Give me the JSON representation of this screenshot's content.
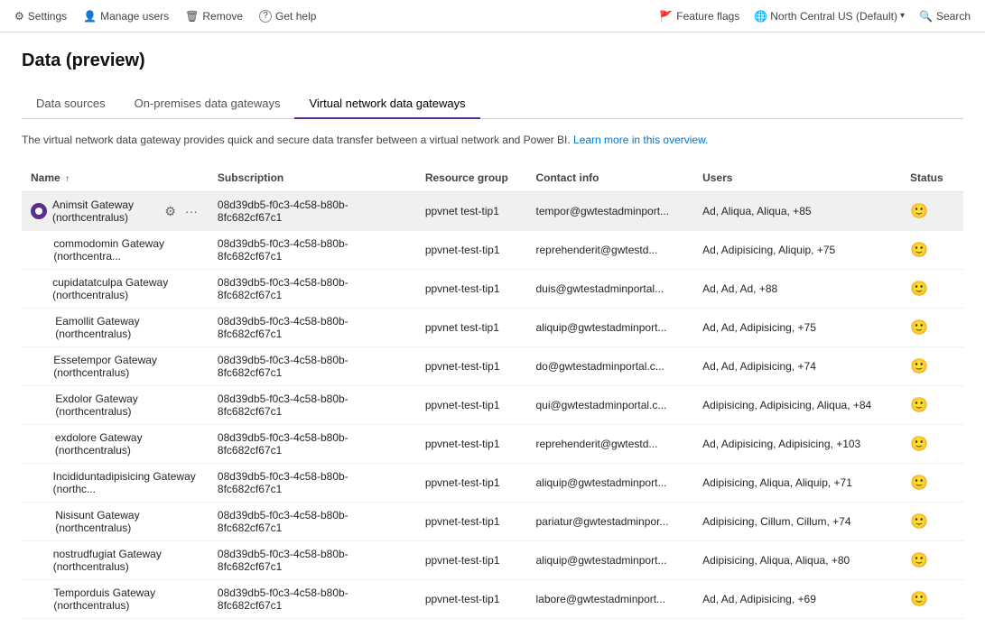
{
  "topbar": {
    "left": [
      {
        "id": "settings",
        "icon": "⚙",
        "label": "Settings"
      },
      {
        "id": "manage-users",
        "icon": "👤",
        "label": "Manage users"
      },
      {
        "id": "remove",
        "icon": "🗑",
        "label": "Remove"
      },
      {
        "id": "get-help",
        "icon": "?",
        "label": "Get help"
      }
    ],
    "right": {
      "feature_flags": "Feature flags",
      "region": "North Central US (Default)",
      "search": "Search"
    }
  },
  "page": {
    "title": "Data (preview)"
  },
  "tabs": [
    {
      "id": "data-sources",
      "label": "Data sources",
      "active": false
    },
    {
      "id": "on-premises",
      "label": "On-premises data gateways",
      "active": false
    },
    {
      "id": "virtual-network",
      "label": "Virtual network data gateways",
      "active": true
    }
  ],
  "description": {
    "text": "The virtual network data gateway provides quick and secure data transfer between a virtual network and Power BI.",
    "link_text": "Learn more in this overview.",
    "link_href": "#"
  },
  "table": {
    "columns": [
      {
        "id": "name",
        "label": "Name",
        "sort": "↑"
      },
      {
        "id": "subscription",
        "label": "Subscription"
      },
      {
        "id": "resource-group",
        "label": "Resource group"
      },
      {
        "id": "contact-info",
        "label": "Contact info"
      },
      {
        "id": "users",
        "label": "Users"
      },
      {
        "id": "status",
        "label": "Status"
      }
    ],
    "rows": [
      {
        "id": 1,
        "selected": true,
        "name": "Animsit Gateway (northcentralus)",
        "subscription": "08d39db5-f0c3-4c58-b80b-8fc682cf67c1",
        "resource_group": "ppvnet test-tip1",
        "contact_info": "tempor@gwtestadminport...",
        "users": "Ad, Aliqua, Aliqua, +85",
        "status": "ok"
      },
      {
        "id": 2,
        "selected": false,
        "name": "commodomin Gateway (northcentra...",
        "subscription": "08d39db5-f0c3-4c58-b80b-8fc682cf67c1",
        "resource_group": "ppvnet-test-tip1",
        "contact_info": "reprehenderit@gwtestd...",
        "users": "Ad, Adipisicing, Aliquip, +75",
        "status": "ok"
      },
      {
        "id": 3,
        "selected": false,
        "name": "cupidatatculpa Gateway (northcentralus)",
        "subscription": "08d39db5-f0c3-4c58-b80b-8fc682cf67c1",
        "resource_group": "ppvnet-test-tip1",
        "contact_info": "duis@gwtestadminportal...",
        "users": "Ad, Ad, Ad, +88",
        "status": "ok"
      },
      {
        "id": 4,
        "selected": false,
        "name": "Eamollit Gateway (northcentralus)",
        "subscription": "08d39db5-f0c3-4c58-b80b-8fc682cf67c1",
        "resource_group": "ppvnet test-tip1",
        "contact_info": "aliquip@gwtestadminport...",
        "users": "Ad, Ad, Adipisicing, +75",
        "status": "ok"
      },
      {
        "id": 5,
        "selected": false,
        "name": "Essetempor Gateway (northcentralus)",
        "subscription": "08d39db5-f0c3-4c58-b80b-8fc682cf67c1",
        "resource_group": "ppvnet-test-tip1",
        "contact_info": "do@gwtestadminportal.c...",
        "users": "Ad, Ad, Adipisicing, +74",
        "status": "ok"
      },
      {
        "id": 6,
        "selected": false,
        "name": "Exdolor Gateway (northcentralus)",
        "subscription": "08d39db5-f0c3-4c58-b80b-8fc682cf67c1",
        "resource_group": "ppvnet-test-tip1",
        "contact_info": "qui@gwtestadminportal.c...",
        "users": "Adipisicing, Adipisicing, Aliqua, +84",
        "status": "ok"
      },
      {
        "id": 7,
        "selected": false,
        "name": "exdolore Gateway (northcentralus)",
        "subscription": "08d39db5-f0c3-4c58-b80b-8fc682cf67c1",
        "resource_group": "ppvnet-test-tip1",
        "contact_info": "reprehenderit@gwtestd...",
        "users": "Ad, Adipisicing, Adipisicing, +103",
        "status": "ok"
      },
      {
        "id": 8,
        "selected": false,
        "name": "Incididuntadipisicing Gateway (northc...",
        "subscription": "08d39db5-f0c3-4c58-b80b-8fc682cf67c1",
        "resource_group": "ppvnet-test-tip1",
        "contact_info": "aliquip@gwtestadminport...",
        "users": "Adipisicing, Aliqua, Aliquip, +71",
        "status": "ok"
      },
      {
        "id": 9,
        "selected": false,
        "name": "Nisisunt Gateway (northcentralus)",
        "subscription": "08d39db5-f0c3-4c58-b80b-8fc682cf67c1",
        "resource_group": "ppvnet-test-tip1",
        "contact_info": "pariatur@gwtestadminpor...",
        "users": "Adipisicing, Cillum, Cillum, +74",
        "status": "ok"
      },
      {
        "id": 10,
        "selected": false,
        "name": "nostrudfugiat Gateway (northcentralus)",
        "subscription": "08d39db5-f0c3-4c58-b80b-8fc682cf67c1",
        "resource_group": "ppvnet-test-tip1",
        "contact_info": "aliquip@gwtestadminport...",
        "users": "Adipisicing, Aliqua, Aliqua, +80",
        "status": "ok"
      },
      {
        "id": 11,
        "selected": false,
        "name": "Temporduis Gateway (northcentralus)",
        "subscription": "08d39db5-f0c3-4c58-b80b-8fc682cf67c1",
        "resource_group": "ppvnet-test-tip1",
        "contact_info": "labore@gwtestadminport...",
        "users": "Ad, Ad, Adipisicing, +69",
        "status": "ok"
      }
    ]
  }
}
